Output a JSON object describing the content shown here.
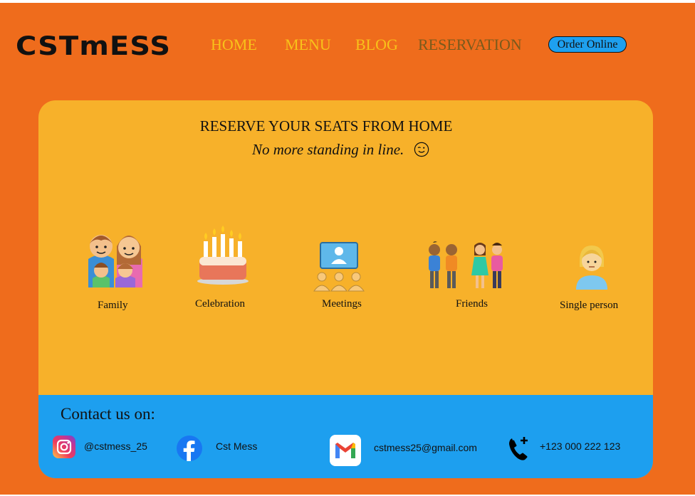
{
  "header": {
    "logo": "CSTmESS",
    "nav": [
      {
        "label": "HOME",
        "active": false
      },
      {
        "label": "MENU",
        "active": false
      },
      {
        "label": "BLOG",
        "active": false
      },
      {
        "label": "RESERVATION",
        "active": true
      }
    ],
    "order_button": "Order Online"
  },
  "colors": {
    "background": "#ef6c1c",
    "card": "#f7b12a",
    "nav_text": "#f8c21a",
    "nav_active": "#7a5a1c",
    "footer": "#1d9fef",
    "order_button": "#1ea0ef"
  },
  "reservation": {
    "headline": "RESERVE YOUR SEATS FROM HOME",
    "subline": "No more standing in line.",
    "subline_icon": "winking-face-icon",
    "categories": [
      {
        "label": "Family",
        "icon": "family-icon"
      },
      {
        "label": "Celebration",
        "icon": "birthday-cake-icon"
      },
      {
        "label": "Meetings",
        "icon": "meeting-icon"
      },
      {
        "label": "Friends",
        "icon": "friends-icon"
      },
      {
        "label": "Single person",
        "icon": "person-icon"
      }
    ]
  },
  "contact": {
    "title": "Contact us on:",
    "items": [
      {
        "icon": "instagram-icon",
        "text": "@cstmess_25"
      },
      {
        "icon": "facebook-icon",
        "text": "Cst Mess"
      },
      {
        "icon": "gmail-icon",
        "text": "cstmess25@gmail.com"
      },
      {
        "icon": "phone-icon",
        "text": "+123 000 222 123"
      }
    ]
  }
}
